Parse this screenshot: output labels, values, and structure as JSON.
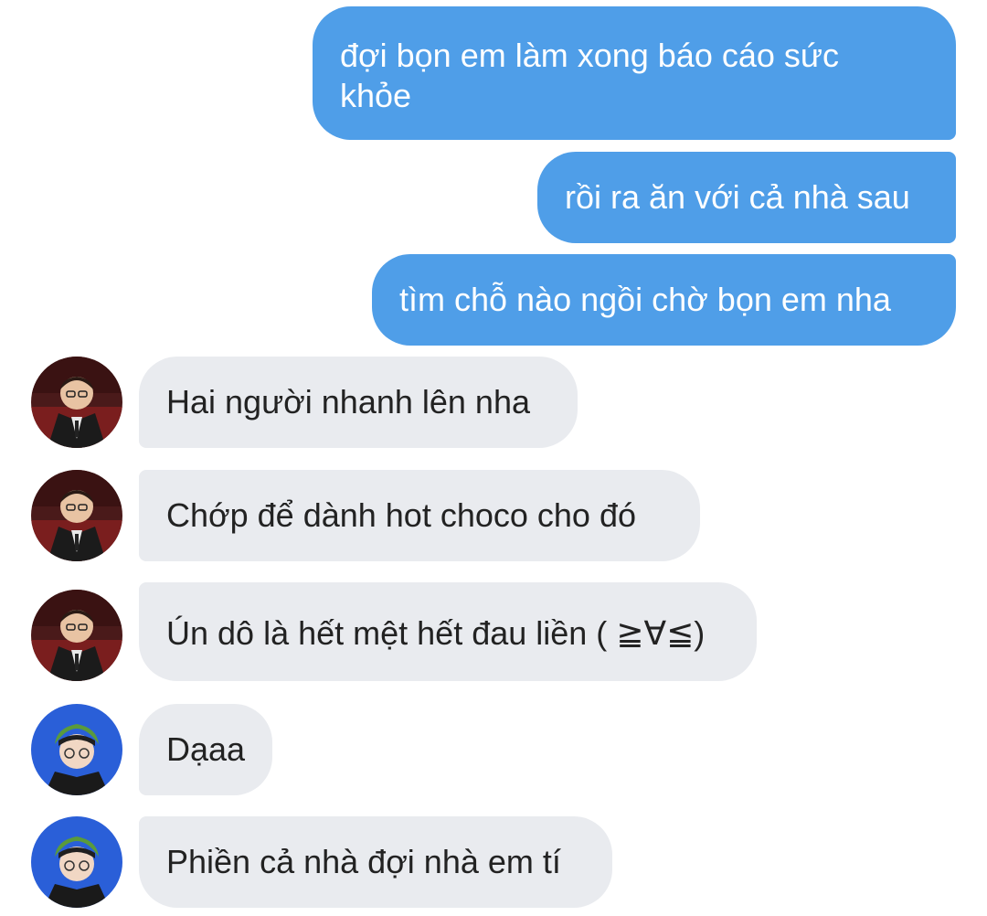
{
  "colors": {
    "outgoing_bubble": "#4f9ee8",
    "incoming_bubble": "#e9ebef",
    "outgoing_text": "#ffffff",
    "incoming_text": "#222222"
  },
  "messages": [
    {
      "direction": "outgoing",
      "lines": [
        "đợi bọn em làm xong báo cáo sức",
        "khỏe"
      ]
    },
    {
      "direction": "outgoing",
      "text": "rồi ra ăn với cả nhà sau"
    },
    {
      "direction": "outgoing",
      "text": "tìm chỗ nào ngồi chờ bọn em nha"
    },
    {
      "direction": "incoming",
      "sender_avatar": "avatar-person-suit",
      "text": "Hai người nhanh lên nha"
    },
    {
      "direction": "incoming",
      "sender_avatar": "avatar-person-suit",
      "text": "Chớp để dành hot choco cho đó"
    },
    {
      "direction": "incoming",
      "sender_avatar": "avatar-person-suit",
      "text": "Ún dô là hết mệt hết đau liền ( ≧∀≦)"
    },
    {
      "direction": "incoming",
      "sender_avatar": "avatar-person-green-hat",
      "text": "Dạaa"
    },
    {
      "direction": "incoming",
      "sender_avatar": "avatar-person-green-hat",
      "text": "Phiền cả nhà đợi nhà em tí"
    }
  ]
}
